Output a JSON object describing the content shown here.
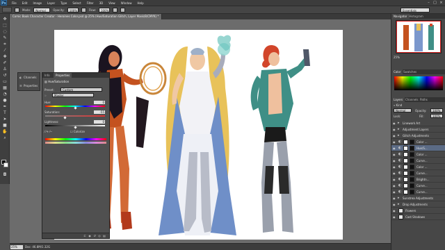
{
  "app": {
    "logo": "Ps"
  },
  "menu": [
    "File",
    "Edit",
    "Image",
    "Layer",
    "Type",
    "Select",
    "Filter",
    "3D",
    "View",
    "Window",
    "Help"
  ],
  "window_controls": [
    "–",
    "□",
    "×"
  ],
  "options": {
    "mode_label": "Mode:",
    "mode_value": "Normal",
    "opacity_label": "Opacity:",
    "opacity_value": "100%",
    "flow_label": "Flow:",
    "flow_value": "100%",
    "workspace": "Essentials"
  },
  "document": {
    "tab_title": "Comic Book Character Creator - Heroines Color.psd @ 25% (Hue/Saturation Glitch, Layer Mask/8/CMYK) *",
    "zoom": "25%",
    "info": "Doc: 46.8M/1.32G"
  },
  "minidock": {
    "items": [
      {
        "icon": "◐",
        "label": "Channels"
      },
      {
        "icon": "☰",
        "label": "Properties"
      }
    ]
  },
  "properties": {
    "tabs": [
      "Info",
      "Properties"
    ],
    "header": "Hue/Saturation",
    "preset_label": "Preset:",
    "preset_value": "Custom",
    "channel_value": "Master",
    "hue_label": "Hue:",
    "hue_value": "0",
    "saturation_label": "Saturation:",
    "saturation_value": "-55",
    "lightness_label": "Lightness:",
    "lightness_value": "0",
    "colorize_label": "Colorize",
    "hue_position": 0.5,
    "saturation_position": 0.33,
    "lightness_position": 0.5
  },
  "right": {
    "nav_tabs": [
      "Navigator",
      "Histogram"
    ],
    "nav_zoom": "25%",
    "color_tabs": [
      "Color",
      "Swatches"
    ],
    "layers_tabs": [
      "Layers",
      "Channels",
      "Paths"
    ],
    "kind_label": "Kind",
    "blend": "Normal",
    "opacity_label": "Opacity:",
    "opacity_value": "100%",
    "lock_label": "Lock:",
    "fill_label": "Fill:",
    "fill_value": "100%",
    "layers": [
      {
        "name": "Linework Art",
        "type": "group",
        "selected": false
      },
      {
        "name": "Adjustment Layers",
        "type": "group",
        "selected": false
      },
      {
        "name": "Glitch Adjustments",
        "type": "group",
        "selected": false
      },
      {
        "name": "Color ...",
        "type": "adj",
        "selected": false
      },
      {
        "name": "Hue/S...",
        "type": "adj",
        "selected": true
      },
      {
        "name": "Color ...",
        "type": "adj",
        "selected": false
      },
      {
        "name": "Curve...",
        "type": "adj",
        "selected": false
      },
      {
        "name": "Color ...",
        "type": "adj",
        "selected": false
      },
      {
        "name": "Curve...",
        "type": "adj",
        "selected": false
      },
      {
        "name": "Brightn...",
        "type": "adj",
        "selected": false
      },
      {
        "name": "Curve...",
        "type": "adj",
        "selected": false
      },
      {
        "name": "Curve...",
        "type": "adj",
        "selected": false
      },
      {
        "name": "Sunstrea Adjustments",
        "type": "group",
        "selected": false
      },
      {
        "name": "Drop Adjustments",
        "type": "group",
        "selected": false
      },
      {
        "name": "Flowers",
        "type": "layer",
        "selected": false
      },
      {
        "name": "Cast Shadows",
        "type": "layer",
        "selected": false
      }
    ]
  }
}
